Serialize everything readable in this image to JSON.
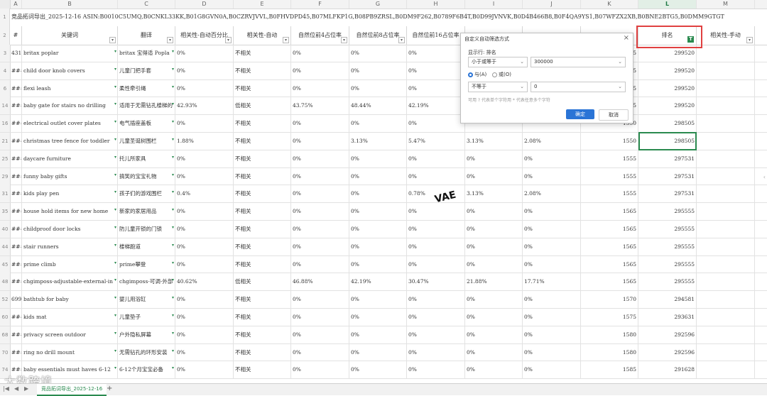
{
  "columns": [
    "A",
    "B",
    "C",
    "D",
    "E",
    "F",
    "G",
    "H",
    "I",
    "J",
    "K",
    "L",
    "M"
  ],
  "title_text": "竞品拓词导出_2025-12-16 ASIN:B0010C5UMQ,B0CNKL33KK,B01G8GVN0A,B0CZRVJVVL,B0FHVDPD45,B07MLFKP1G,B08PB9ZRSL,B0DM9F262,B0789F6B4T,B0D99JVNVK,B0D4B466B8,B0F4QA9YS1,B07WFZX2XB,B0BNE2BTG5,B0DMM9GTGT",
  "header_row_num": "2",
  "headers": [
    "#",
    "关键词",
    "翻译",
    "相关性-自动百分比",
    "相关性-自动",
    "自然位前4占位率",
    "自然位前8占位率",
    "自然位前16占位率",
    "",
    "",
    "",
    "排名",
    "相关性-手动"
  ],
  "rows": [
    {
      "n": "3",
      "c": [
        "431",
        "britax poplar",
        "britax 宝得适 Popla",
        "0%",
        "不相关",
        "0%",
        "0%",
        "0%",
        "",
        "",
        "1545",
        "299520",
        ""
      ]
    },
    {
      "n": "4",
      "c": [
        "###",
        "child door knob covers",
        "儿童门把手套",
        "0%",
        "不相关",
        "0%",
        "0%",
        "0%",
        "",
        "",
        "1545",
        "299520",
        ""
      ]
    },
    {
      "n": "6",
      "c": [
        "###",
        "flexi leash",
        "柔性牵引绳",
        "0%",
        "不相关",
        "0%",
        "0%",
        "0%",
        "",
        "",
        "1545",
        "299520",
        ""
      ]
    },
    {
      "n": "14",
      "c": [
        "###",
        "baby gate for stairs no drilling",
        "适用于无需钻孔楼梯的",
        "42.93%",
        "低相关",
        "43.75%",
        "48.44%",
        "42.19%",
        "",
        "",
        "1545",
        "299520",
        ""
      ]
    },
    {
      "n": "16",
      "c": [
        "###",
        "electrical outlet cover plates",
        "电气插座盖板",
        "0%",
        "不相关",
        "0%",
        "0%",
        "0%",
        "",
        "",
        "1550",
        "298505",
        ""
      ]
    },
    {
      "n": "21",
      "c": [
        "###",
        "christmas tree fence for toddler",
        "儿童圣诞树围栏",
        "1.88%",
        "不相关",
        "0%",
        "3.13%",
        "5.47%",
        "3.13%",
        "2.08%",
        "1550",
        "298505",
        ""
      ]
    },
    {
      "n": "25",
      "c": [
        "###",
        "daycare furniture",
        "托儿所家具",
        "0%",
        "不相关",
        "0%",
        "0%",
        "0%",
        "0%",
        "0%",
        "1555",
        "297531",
        ""
      ]
    },
    {
      "n": "29",
      "c": [
        "###",
        "funny baby gifts",
        "搞笑的宝宝礼物",
        "0%",
        "不相关",
        "0%",
        "0%",
        "0%",
        "0%",
        "0%",
        "1555",
        "297531",
        ""
      ]
    },
    {
      "n": "31",
      "c": [
        "###",
        "kids play pen",
        "孩子们的游戏围栏",
        "0.4%",
        "不相关",
        "0%",
        "0%",
        "0.78%",
        "3.13%",
        "2.08%",
        "1555",
        "297531",
        ""
      ]
    },
    {
      "n": "35",
      "c": [
        "###",
        "house hold items for new home",
        "新家的家居用品",
        "0%",
        "不相关",
        "0%",
        "0%",
        "0%",
        "0%",
        "0%",
        "1565",
        "295555",
        ""
      ]
    },
    {
      "n": "40",
      "c": [
        "###",
        "childproof door locks",
        "防儿童开锁的门锁",
        "0%",
        "不相关",
        "0%",
        "0%",
        "0%",
        "0%",
        "0%",
        "1565",
        "295555",
        ""
      ]
    },
    {
      "n": "44",
      "c": [
        "###",
        "stair runners",
        "楼梯跑道",
        "0%",
        "不相关",
        "0%",
        "0%",
        "0%",
        "0%",
        "0%",
        "1565",
        "295555",
        ""
      ]
    },
    {
      "n": "45",
      "c": [
        "###",
        "prime climb",
        "prime攀登",
        "0%",
        "不相关",
        "0%",
        "0%",
        "0%",
        "0%",
        "0%",
        "1565",
        "295555",
        ""
      ]
    },
    {
      "n": "48",
      "c": [
        "###",
        "chgimposs-adjustable-external-in",
        "chgimposs-可调-外部",
        "40.62%",
        "低相关",
        "46.88%",
        "42.19%",
        "30.47%",
        "21.88%",
        "17.71%",
        "1565",
        "295555",
        ""
      ]
    },
    {
      "n": "52",
      "c": [
        "699",
        "bathtub for baby",
        "婴儿用浴缸",
        "0%",
        "不相关",
        "0%",
        "0%",
        "0%",
        "0%",
        "0%",
        "1570",
        "294581",
        ""
      ]
    },
    {
      "n": "60",
      "c": [
        "###",
        "kids mat",
        "儿童垫子",
        "0%",
        "不相关",
        "0%",
        "0%",
        "0%",
        "0%",
        "0%",
        "1575",
        "293631",
        ""
      ]
    },
    {
      "n": "68",
      "c": [
        "###",
        "privacy screen outdoor",
        "户外隐私屏幕",
        "0%",
        "不相关",
        "0%",
        "0%",
        "0%",
        "0%",
        "0%",
        "1580",
        "292596",
        ""
      ]
    },
    {
      "n": "70",
      "c": [
        "###",
        "ring no drill mount",
        "无需钻孔的环形安装",
        "0%",
        "不相关",
        "0%",
        "0%",
        "0%",
        "0%",
        "0%",
        "1580",
        "292596",
        ""
      ]
    },
    {
      "n": "74",
      "c": [
        "###",
        "baby essentials must haves 6-12",
        "6-12个月宝宝必备",
        "0%",
        "不相关",
        "0%",
        "0%",
        "0%",
        "0%",
        "0%",
        "1585",
        "291628",
        ""
      ]
    }
  ],
  "dialog": {
    "title": "自定义自动筛选方式",
    "close": "×",
    "show_rows_label": "显示行: 排名",
    "condition1": "小于或等于",
    "value1": "300000",
    "and_label": "与(A)",
    "or_label": "或(O)",
    "condition2": "不等于",
    "value2": "0",
    "hint": "可用 ? 代表单个字符用 * 代表任意多个字符",
    "ok_label": "确定",
    "cancel_label": "取消"
  },
  "watermark": "VAE",
  "logo_text": "大数跨境",
  "sheet_tab": "竞品拓词导出_2025-12-16",
  "add_sheet": "+",
  "nav_left": "|◀",
  "nav_prev": "◀",
  "nav_next": "▶",
  "nav_right": "▶|"
}
